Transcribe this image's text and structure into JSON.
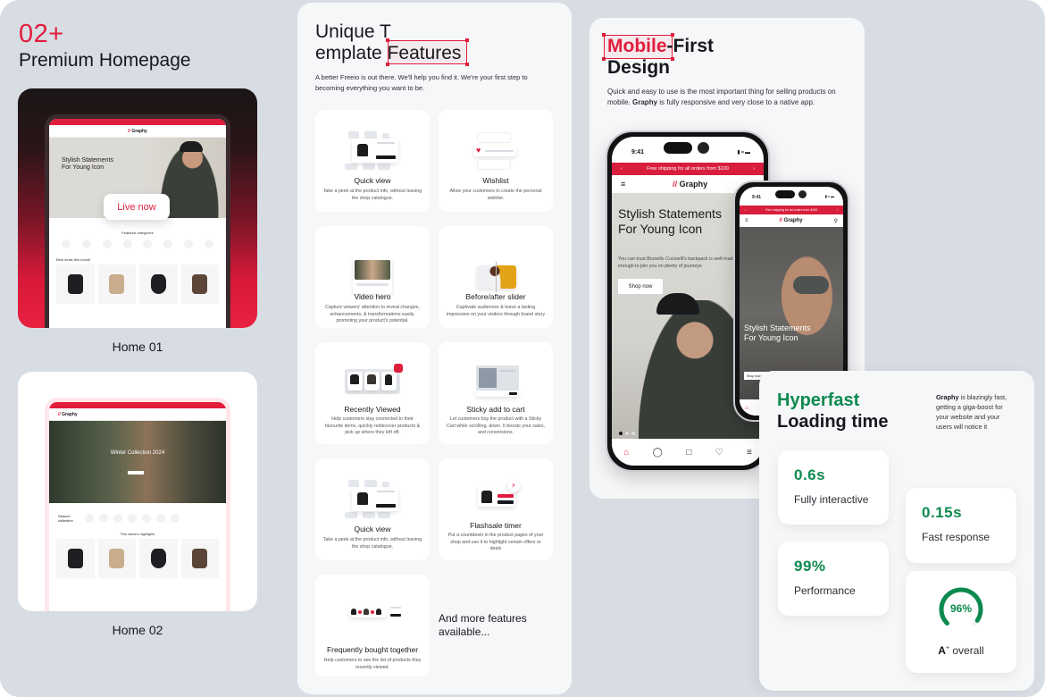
{
  "colors": {
    "brand_red": "#e11d3c",
    "accent_green": "#0e8a4f",
    "background": "#d8dde4",
    "panel": "#f6f7f9",
    "text_dark": "#17181c"
  },
  "homepages": {
    "count": "02+",
    "title": "Premium Homepage",
    "items": [
      {
        "label": "Home 01",
        "badge": "Live now",
        "preview": {
          "brand": "Graphy",
          "hero_title": "Stylish Statements For Young Icon",
          "section_1": "Featured categories",
          "section_2": "Best deals this month"
        }
      },
      {
        "label": "Home 02",
        "preview": {
          "brand": "Graphy",
          "hero_title": "Winter Collection 2024",
          "section_1": "Season collection",
          "section_2": "This week's highlights"
        }
      }
    ]
  },
  "features": {
    "title_line1": "Unique T",
    "title_line2a": "emplate",
    "title_line2b": "Features",
    "description": "A better Freeio is out there. We'll help you find it. We're your first step to becoming everything you want to be.",
    "items": [
      {
        "title": "Quick view",
        "icon": "quick-view-icon",
        "desc": "Take a peek at the product info, without leaving the shop catalogue."
      },
      {
        "title": "Wishlist",
        "icon": "wishlist-heart-icon",
        "desc": "Allow your customers to create the personal wishlist."
      },
      {
        "title": "Video hero",
        "icon": "video-hero-icon",
        "desc": "Capture viewers' attention to reveal changes, enhancements, & transformations easily, promoting your product's potential."
      },
      {
        "title": "Before/after slider",
        "icon": "before-after-icon",
        "desc": "Captivate audiences & leave a lasting impression on your visitors through brand story"
      },
      {
        "title": "Recently Viewed",
        "icon": "recently-viewed-icon",
        "desc": "Help customers stay connected to their favourite items, quickly rediscover products & pick up where they left off."
      },
      {
        "title": "Sticky add to cart",
        "icon": "sticky-cart-icon",
        "desc": "Let customers buy the product with a Sticky Cart while scrolling, down. It boosts your sales, and conversions."
      },
      {
        "title": "Quick view",
        "icon": "quick-view-icon",
        "desc": "Take a peek at the product info, without leaving the shop catalogue."
      },
      {
        "title": "Flashsale timer",
        "icon": "flash-sale-icon",
        "desc": "Put a countdown in the product pages of your shop and use it to highlight certain offers or deals"
      },
      {
        "title": "Frequently bought together",
        "icon": "bundle-icon",
        "desc": "Help customers to see the list of products they recently viewed."
      }
    ],
    "more": "And more features available..."
  },
  "mobile": {
    "title_red": "Mobile",
    "title_rest": "-First",
    "title_line2": "Design",
    "desc_before": "Quick and easy to use is the most important thing for selling products on mobile. ",
    "desc_brand": "Graphy",
    "desc_after": " is fully responsive and very close to a native app.",
    "phone": {
      "time": "9:41",
      "ship_bar": "Free shipping for all orders from $100",
      "brand": "Graphy",
      "hero_title": "Stylish Statements For Young Icon",
      "hero_text": "You can trust Brunello Cucinelli's backpack is well-made enough to join you on plenty of journeys",
      "cta": "Shop now"
    }
  },
  "performance": {
    "title_green": "Hyperfast",
    "title_dark": "Loading time",
    "desc_brand": "Graphy",
    "desc_rest": " is blazingly fast, getting a giga-boost for your website and your users will notice it",
    "metrics": [
      {
        "value": "0.6s",
        "label": "Fully interactive"
      },
      {
        "value": "0.15s",
        "label": "Fast response"
      },
      {
        "value": "99%",
        "label": "Performance"
      }
    ],
    "overall": {
      "value": "96%",
      "percent": 96,
      "grade": "A",
      "grade_sup": "+",
      "label": "overall"
    }
  }
}
